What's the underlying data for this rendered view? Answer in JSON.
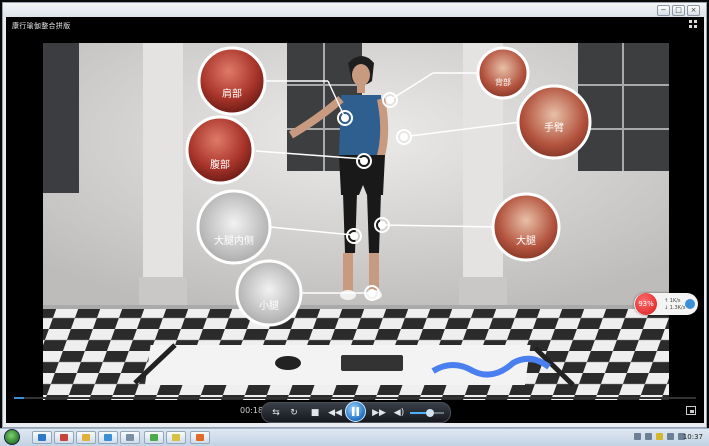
{
  "window": {
    "minimize_glyph": "−",
    "maximize_glyph": "□",
    "close_glyph": "×"
  },
  "player": {
    "title": "康行瑜伽整合拼版",
    "grid_icon": "grid-icon",
    "time": "00:18",
    "progress_fraction": 0.014,
    "volume_fraction": 0.6,
    "state": "playing"
  },
  "controls": {
    "repeat": "repeat-icon",
    "rewind": "rewind-icon",
    "stop": "stop-icon",
    "prev": "previous-icon",
    "play_pause": "pause-icon",
    "next": "next-icon",
    "volume": "speaker-icon",
    "pip": "picture-in-picture-icon"
  },
  "muscles": [
    {
      "label": "肩部"
    },
    {
      "label": "背部"
    },
    {
      "label": "腹部"
    },
    {
      "label": "手臂"
    },
    {
      "label": "大腿内侧"
    },
    {
      "label": "大腿"
    },
    {
      "label": "小腿"
    }
  ],
  "network_badge": {
    "percent": "93%",
    "upload": "1K/s",
    "download": "1.3K/s"
  },
  "taskbar": {
    "clock": "10:37",
    "buttons": [
      "ie-icon",
      "folder-icon",
      "media-icon",
      "windows-icon",
      "app-icon",
      "chrome-icon",
      "program-icon",
      "app-icon-2"
    ]
  },
  "colors": {
    "accent": "#3a8fd8",
    "badge_red": "#d61c1c",
    "room_wall": "#d8d8d6"
  }
}
